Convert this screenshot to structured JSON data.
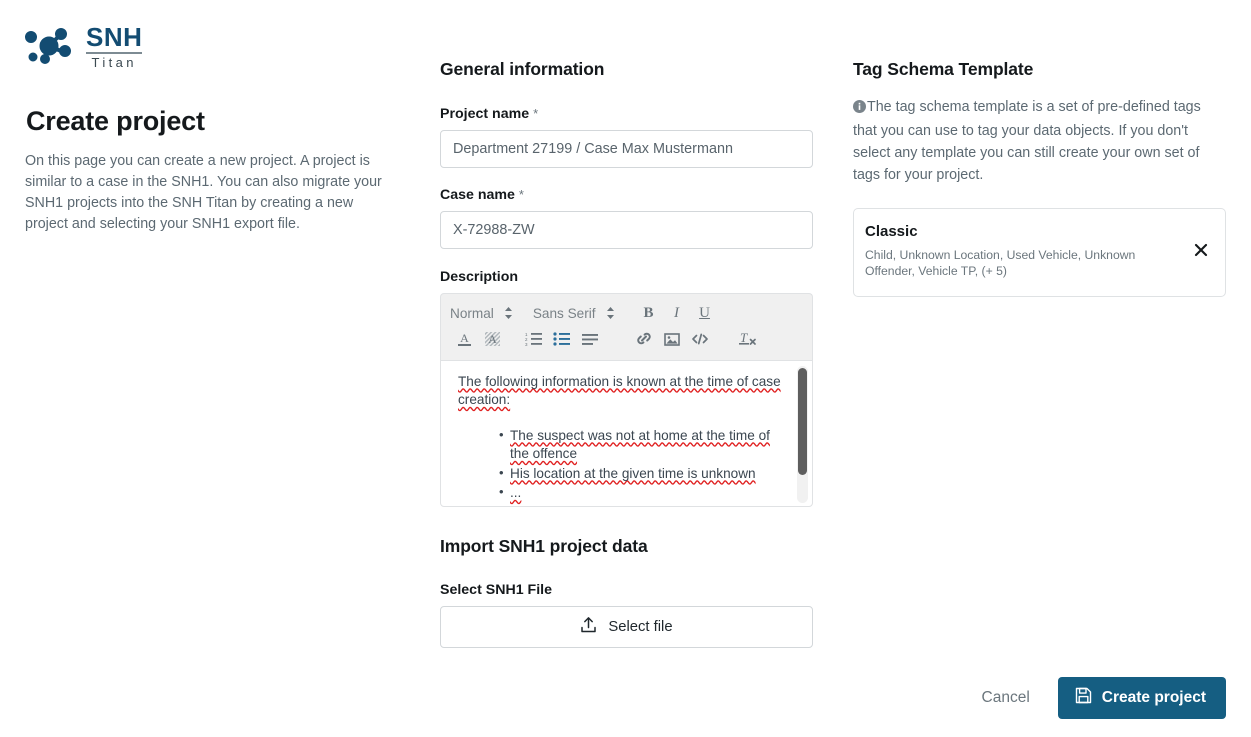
{
  "brand": {
    "logo_icon": "snh-molecule-logo-icon",
    "name": "SNH",
    "subtitle": "Titan"
  },
  "intro": {
    "title": "Create project",
    "description": "On this page you can create a new project. A project is similar to a case in the SNH1. You can also migrate your SNH1 projects into the SNH Titan by creating a new project and selecting your SNH1 export file."
  },
  "general": {
    "heading": "General information",
    "project_name": {
      "label": "Project name",
      "required_marker": "*",
      "value": "Department 27199 / Case Max Mustermann",
      "placeholder": "Department 27199 / Case Max Mustermann"
    },
    "case_name": {
      "label": "Case name",
      "required_marker": "*",
      "value": "X-72988-ZW",
      "placeholder": "X-72988-ZW"
    },
    "description": {
      "label": "Description",
      "toolbar": {
        "heading_select": "Normal",
        "font_select": "Sans Serif",
        "bold": "B",
        "italic": "I",
        "underline": "U",
        "icons": [
          "text-color-icon",
          "background-color-icon",
          "ordered-list-icon",
          "bullet-list-icon",
          "align-icon",
          "link-icon",
          "image-icon",
          "code-block-icon",
          "clear-formatting-icon"
        ]
      },
      "paragraph": "The following information is known at the time of case creation:",
      "bullets": [
        "The suspect was not at home at the time of the offence",
        "His location at the given time is unknown",
        "..."
      ]
    }
  },
  "import": {
    "heading": "Import SNH1 project data",
    "file_label": "Select SNH1 File",
    "select_file_button": "Select file",
    "upload_icon": "upload-icon"
  },
  "tag_schema": {
    "heading": "Tag Schema Template",
    "info_icon": "info-icon",
    "info_text": "The tag schema template is a set of pre-defined tags that you can use to tag your data objects. If you don't select any template you can still create your own set of tags for your project.",
    "selected_template": {
      "name": "Classic",
      "tags": "Child, Unknown Location, Used Vehicle, Unknown Offender, Vehicle TP, (+ 5)",
      "remove_icon": "close-icon"
    }
  },
  "footer": {
    "cancel_label": "Cancel",
    "create_label": "Create project",
    "create_icon": "save-icon"
  },
  "colors": {
    "brand_blue": "#134c72",
    "primary_button": "#155e82",
    "muted_text": "#5c6972",
    "border": "#d3d7da",
    "toolbar_bg": "#f0f0f0",
    "spellcheck_underline": "#e02020"
  }
}
